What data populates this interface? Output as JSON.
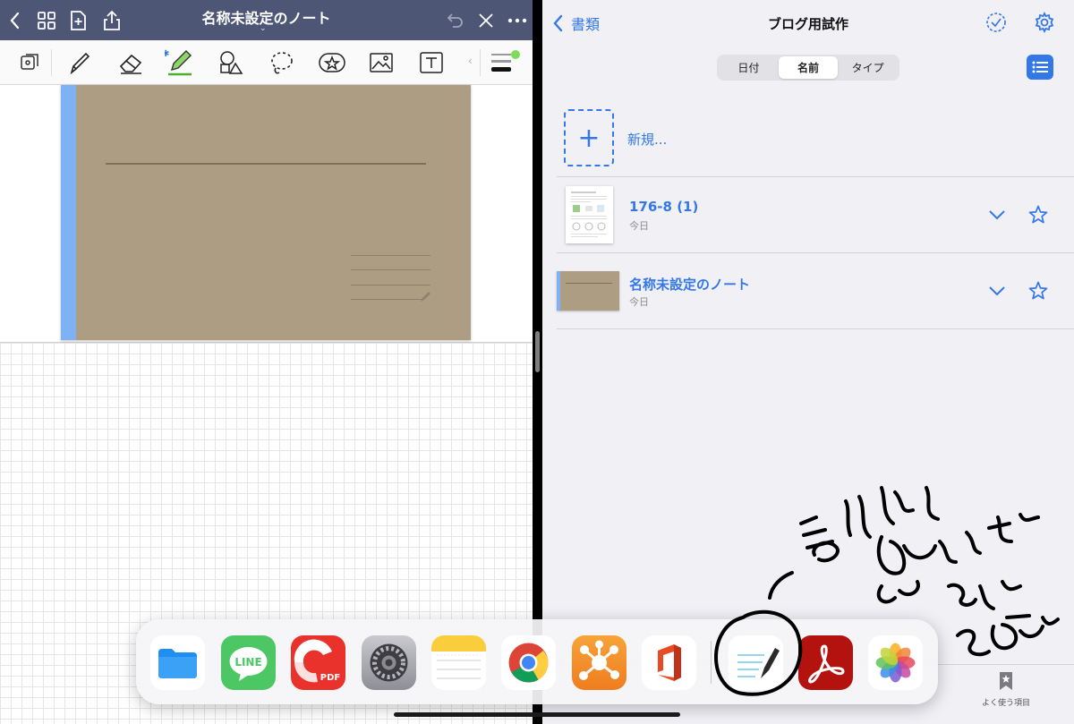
{
  "notes_app": {
    "document_title": "名称未設定のノート",
    "tools": [
      "page-setup-icon",
      "pen-icon",
      "eraser-icon",
      "highlighter-icon",
      "shapes-icon",
      "lasso-icon",
      "sticker-icon",
      "image-icon",
      "text-box-icon"
    ]
  },
  "library": {
    "back_label": "書類",
    "title": "ブログ用試作",
    "sort_options": [
      "日付",
      "名前",
      "タイプ"
    ],
    "active_sort": "名前",
    "new_label": "新規...",
    "items": [
      {
        "title": "176-8 (1)",
        "subtitle": "今日"
      },
      {
        "title": "名称未設定のノート",
        "subtitle": "今日"
      }
    ],
    "favorites_tab_label": "よく使う項目"
  },
  "dock": {
    "apps": [
      "Files",
      "LINE",
      "PDF Expert",
      "Settings",
      "Notes",
      "Chrome",
      "MindNode",
      "Office",
      "GoodNotes",
      "Adobe Acrobat",
      "Photos"
    ],
    "line_logo_text": "LINE",
    "pdf_badge_text": "PDF"
  },
  "colors": {
    "accent": "#3378e6",
    "title_bar": "#4d5675",
    "cover": "#ad9d83",
    "spine": "#7fb2f4"
  }
}
